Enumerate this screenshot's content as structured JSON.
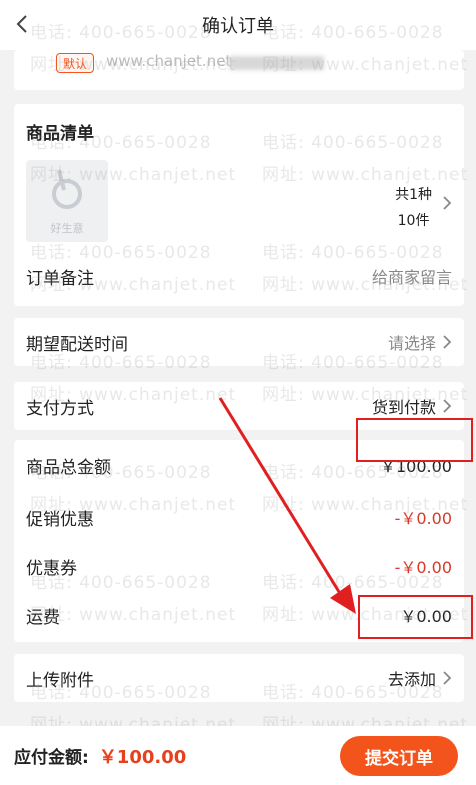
{
  "header": {
    "title": "确认订单"
  },
  "address": {
    "default_tag": "默认",
    "text": "www.chanjet.net"
  },
  "goods": {
    "section_title": "商品清单",
    "thumb_label": "好生意",
    "kinds": "共1种",
    "qty": "10件",
    "remark_label": "订单备注",
    "remark_placeholder": "给商家留言"
  },
  "delivery": {
    "label": "期望配送时间",
    "value": "请选择"
  },
  "payment": {
    "label": "支付方式",
    "value": "货到付款"
  },
  "amounts": {
    "goods_total_label": "商品总金额",
    "goods_total": "￥100.00",
    "promo_label": "促销优惠",
    "promo": "-￥0.00",
    "coupon_label": "优惠券",
    "coupon": "-￥0.00",
    "freight_label": "运费",
    "freight": "￥0.00"
  },
  "attachment": {
    "label": "上传附件",
    "value": "去添加"
  },
  "footer": {
    "total_label": "应付金额:",
    "total_value": "￥100.00",
    "submit": "提交订单"
  },
  "watermark": {
    "phone": "电话: 400-665-0028",
    "site": "网址: www.chanjet.net"
  },
  "colors": {
    "accent": "#f2541b",
    "price_red": "#e8401c",
    "highlight": "#e02020"
  }
}
